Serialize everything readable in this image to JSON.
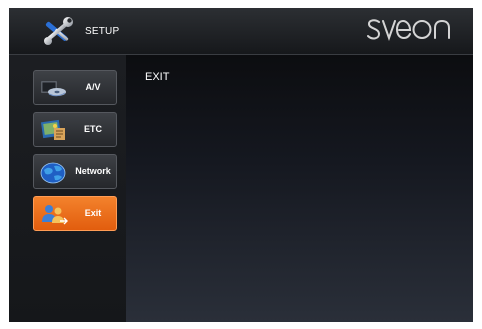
{
  "header": {
    "title": "SETUP",
    "brand": "SVEON",
    "icon": "setup-tools-icon"
  },
  "sidebar": {
    "items": [
      {
        "label": "A/V",
        "icon": "av-icon",
        "selected": false
      },
      {
        "label": "ETC",
        "icon": "etc-icon",
        "selected": false
      },
      {
        "label": "Network",
        "icon": "network-globe-icon",
        "selected": false
      },
      {
        "label": "Exit",
        "icon": "exit-users-icon",
        "selected": true
      }
    ]
  },
  "content": {
    "title": "EXIT"
  },
  "colors": {
    "accent": "#f0782a",
    "background": "#121418",
    "text": "#ffffff"
  }
}
